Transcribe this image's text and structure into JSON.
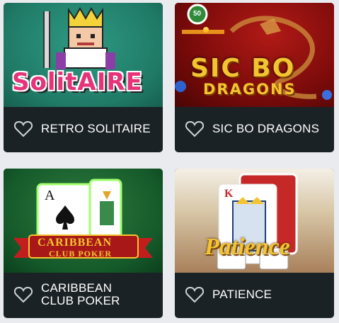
{
  "games": [
    {
      "title": "RETRO SOLITAIRE",
      "logo": "SolitAIRE",
      "icon": "heart-icon"
    },
    {
      "title": "SIC BO DRAGONS",
      "logo_line1": "SIC BO",
      "logo_line2": "DRAGONS",
      "chip": "50",
      "icon": "heart-icon"
    },
    {
      "title": "CARIBBEAN CLUB POKER",
      "logo_line1": "CARIBBEAN",
      "logo_line2": "CLUB POKER",
      "icon": "heart-icon"
    },
    {
      "title": "PATIENCE",
      "logo": "Patience",
      "icon": "heart-icon"
    }
  ],
  "colors": {
    "card_bg": "#1b2226",
    "page_bg": "#e9ebee",
    "caption_text": "#ffffff",
    "heart_stroke": "#cfd3d6"
  }
}
